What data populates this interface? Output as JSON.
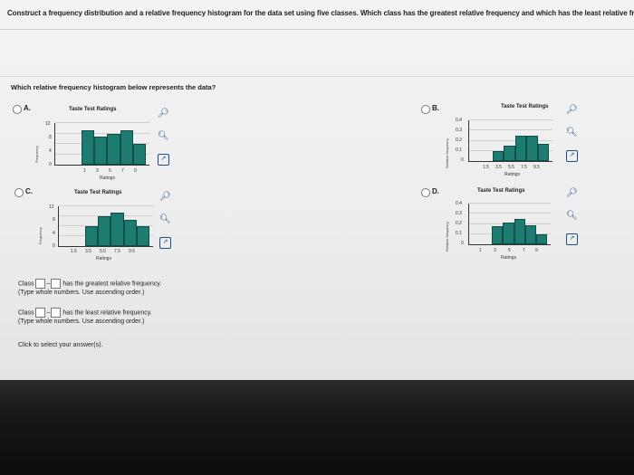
{
  "question": "Construct a frequency distribution and a relative frequency histogram for the data set using five classes. Which class has the greatest relative frequency and which has the least relative fr",
  "sub_question": "Which relative frequency histogram below represents the data?",
  "options": [
    {
      "label": "A.",
      "title": "Taste Test Ratings",
      "ylabel": "Frequency",
      "xlabel": "Ratings",
      "yticks": [
        "12",
        "8",
        "4",
        "0"
      ],
      "xticks": [
        "1",
        "3",
        "5",
        "7",
        "9"
      ]
    },
    {
      "label": "B.",
      "title": "Taste Test Ratings",
      "ylabel": "Relative frequency",
      "xlabel": "Ratings",
      "yticks": [
        "0.4",
        "0.3",
        "0.2",
        "0.1",
        "0"
      ],
      "xticks": [
        "1.5",
        "3.5",
        "5.5",
        "7.5",
        "9.5"
      ]
    },
    {
      "label": "C.",
      "title": "Taste Test Ratings",
      "ylabel": "Frequency",
      "xlabel": "Ratings",
      "yticks": [
        "12",
        "8",
        "4",
        "0"
      ],
      "xticks": [
        "1.5",
        "3.5",
        "5.5",
        "7.5",
        "9.5"
      ]
    },
    {
      "label": "D.",
      "title": "Taste Test Ratings",
      "ylabel": "Relative frequency",
      "xlabel": "Ratings",
      "yticks": [
        "0.4",
        "0.3",
        "0.2",
        "0.1",
        "0"
      ],
      "xticks": [
        "1",
        "3",
        "5",
        "7",
        "9"
      ]
    }
  ],
  "answers": {
    "class_label": "Class",
    "greatest_text": "has the greatest relative frequency.",
    "least_text": "has the least relative frequency.",
    "hint": "(Type whole numbers. Use ascending order.)"
  },
  "click_text": "Click to select your answer(s).",
  "icons": [
    "zoom-in-icon",
    "zoom-out-icon",
    "popout-icon"
  ],
  "colors": {
    "bar": "#1d7b72",
    "tool": "#1b4e86"
  },
  "chart_data": [
    {
      "type": "bar",
      "option": "A",
      "title": "Taste Test Ratings",
      "xlabel": "Ratings",
      "ylabel": "Frequency",
      "ylim": [
        0,
        12
      ],
      "values": [
        10,
        8,
        9,
        10,
        6
      ]
    },
    {
      "type": "bar",
      "option": "B",
      "title": "Taste Test Ratings",
      "xlabel": "Ratings",
      "ylabel": "Relative frequency",
      "ylim": [
        0,
        0.4
      ],
      "values": [
        0.1,
        0.15,
        0.25,
        0.25,
        0.17
      ]
    },
    {
      "type": "bar",
      "option": "C",
      "title": "Taste Test Ratings",
      "xlabel": "Ratings",
      "ylabel": "Frequency",
      "ylim": [
        0,
        12
      ],
      "values": [
        6,
        9,
        10,
        8,
        6
      ]
    },
    {
      "type": "bar",
      "option": "D",
      "title": "Taste Test Ratings",
      "xlabel": "Ratings",
      "ylabel": "Relative frequency",
      "ylim": [
        0,
        0.4
      ],
      "values": [
        0.18,
        0.21,
        0.25,
        0.19,
        0.1
      ]
    }
  ]
}
